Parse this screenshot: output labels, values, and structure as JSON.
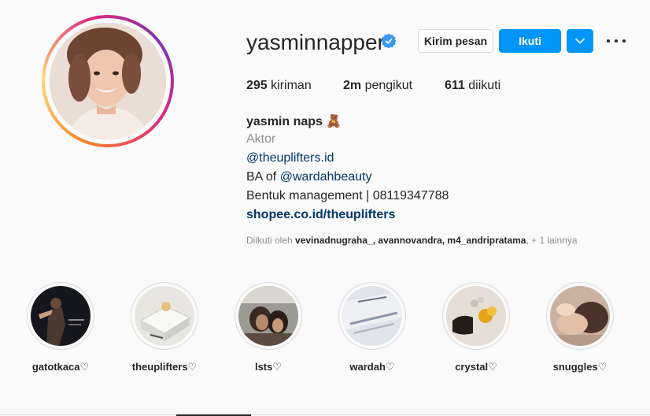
{
  "profile": {
    "username": "yasminnapper",
    "verified": true,
    "buttons": {
      "message": "Kirim pesan",
      "follow": "Ikuti"
    },
    "stats": {
      "posts_count": "295",
      "posts_label": "kiriman",
      "followers_count": "2m",
      "followers_label": "pengikut",
      "following_count": "611",
      "following_label": "diikuti"
    },
    "bio": {
      "full_name": "yasmin naps",
      "emoji": "🧸",
      "category": "Aktor",
      "mention_line": "@theuplifters.id",
      "ba_prefix": "BA of ",
      "ba_mention": "@wardahbeauty",
      "management": "Bentuk management | 08119347788",
      "link": "shopee.co.id/theuplifters"
    },
    "followed_by": {
      "prefix": "Diikuti oleh ",
      "names": "vevinadnugraha_, avannovandra, m4_andripratama",
      "suffix": ", + 1 lainnya"
    }
  },
  "highlights": [
    {
      "label": "gatotkaca♡"
    },
    {
      "label": "theuplifters♡"
    },
    {
      "label": "lsts♡"
    },
    {
      "label": "wardah♡"
    },
    {
      "label": "crystal♡"
    },
    {
      "label": "snuggles♡"
    }
  ],
  "colors": {
    "primary": "#0095f6",
    "verified": "#3897f0",
    "text": "#262626",
    "secondary": "#8e8e8e",
    "link": "#00376b"
  },
  "icons": [
    "verified-badge-icon",
    "chevron-down-icon",
    "more-options-icon"
  ]
}
